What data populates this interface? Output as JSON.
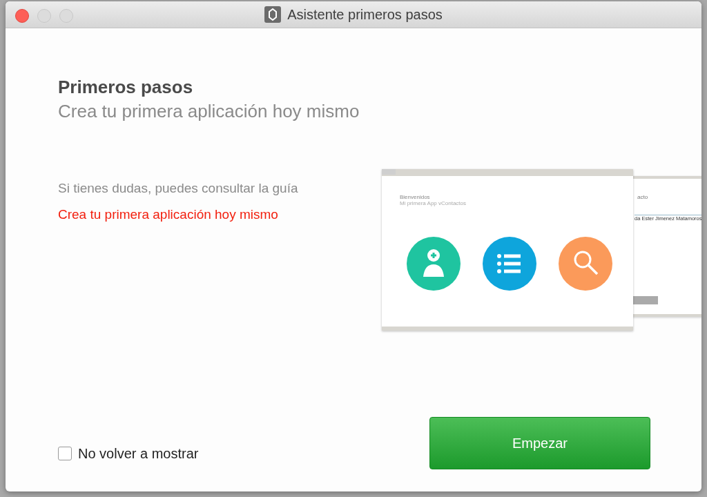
{
  "window": {
    "title": "Asistente primeros pasos"
  },
  "heading": {
    "title": "Primeros pasos",
    "subtitle": "Crea tu primera aplicación hoy mismo"
  },
  "help": {
    "text": "Si tienes dudas, puedes consultar la guía",
    "link": "Crea tu primera aplicación hoy mismo"
  },
  "preview": {
    "title": "Bienvenidos",
    "subtitle": "Mi primera App vContactos",
    "back_title": "acto",
    "back_name": "da Ester Jimenez Matamoros",
    "tiles": [
      {
        "kind": "add-contact",
        "color": "#1fc4a0"
      },
      {
        "kind": "list",
        "color": "#0ea5dc"
      },
      {
        "kind": "search",
        "color": "#fb9a5a"
      }
    ]
  },
  "dont_show": {
    "label": "No volver a mostrar",
    "checked": false
  },
  "start_button": {
    "label": "Empezar"
  }
}
